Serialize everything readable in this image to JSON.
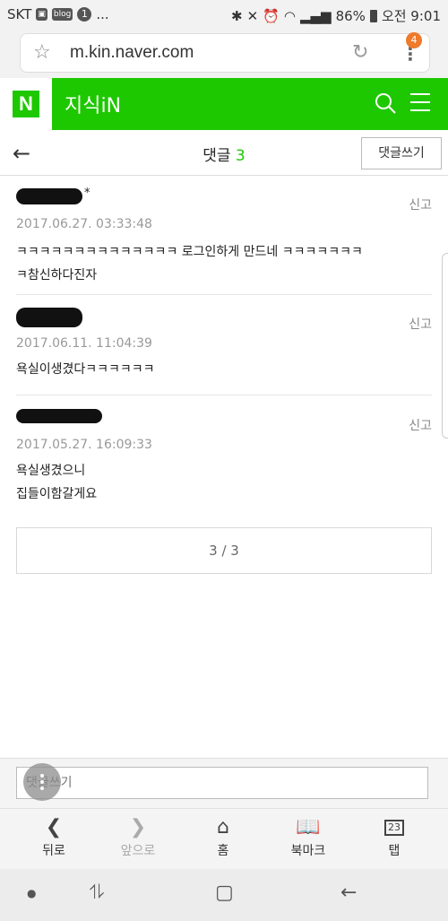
{
  "status": {
    "carrier": "SKT",
    "blog_icon": "blog",
    "notif_num": "1",
    "more": "...",
    "battery": "86%",
    "time": "오전 9:01"
  },
  "browser": {
    "url": "m.kin.naver.com",
    "tab_badge": "4"
  },
  "header": {
    "logo": "N",
    "title": "지식iN"
  },
  "comments_header": {
    "title": "댓글",
    "count": "3",
    "write_button": "댓글쓰기"
  },
  "comments": [
    {
      "date": "2017.06.27. 03:33:48",
      "report": "신고",
      "text": "ㅋㅋㅋㅋㅋㅋㅋㅋㅋㅋㅋㅋㅋㅋ 로그인하게 만드네 ㅋㅋㅋㅋㅋㅋㅋ\nㅋ참신하다진자"
    },
    {
      "date": "2017.06.11. 11:04:39",
      "report": "신고",
      "text": "욕실이생겼다ㅋㅋㅋㅋㅋㅋ"
    },
    {
      "date": "2017.05.27. 16:09:33",
      "report": "신고",
      "text": "욕실생겼으니\n집들이함갈게요"
    }
  ],
  "pagination": {
    "label": "3 / 3"
  },
  "comment_input": {
    "placeholder": "댓글쓰기"
  },
  "bottom_nav": {
    "back": "뒤로",
    "forward": "앞으로",
    "home": "홈",
    "bookmark": "북마크",
    "tabs": "탭",
    "tabs_count": "23"
  },
  "colors": {
    "naver_green": "#1ec800",
    "badge_orange": "#ef7a2a"
  }
}
